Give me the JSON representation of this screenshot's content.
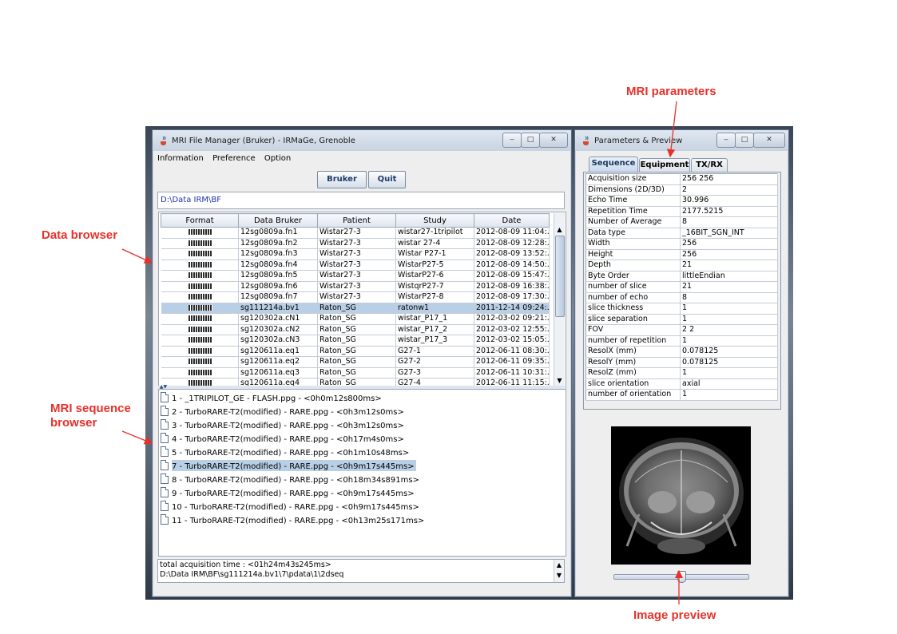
{
  "annotations": {
    "mri_parameters": "MRI parameters",
    "data_browser": "Data browser",
    "mri_sequence_browser": "MRI sequence\nbrowser",
    "image_preview": "Image preview"
  },
  "main_window": {
    "title": "MRI File Manager (Bruker) - IRMaGe, Grenoble",
    "menu": [
      "Information",
      "Preference",
      "Option"
    ],
    "buttons": {
      "bruker": "Bruker",
      "quit": "Quit"
    },
    "path": "D:\\Data IRM\\BF",
    "table": {
      "columns": [
        "Format",
        "Data Bruker",
        "Patient",
        "Study",
        "Date"
      ],
      "rows": [
        [
          "",
          "12sg0809a.fn1",
          "Wistar27-3",
          "wistar27-1tripilot",
          "2012-08-09  11:04:..."
        ],
        [
          "",
          "12sg0809a.fn2",
          "Wistar27-3",
          "wistar 27-4",
          "2012-08-09  12:28:..."
        ],
        [
          "",
          "12sg0809a.fn3",
          "Wistar27-3",
          "Wistar P27-1",
          "2012-08-09  13:52:..."
        ],
        [
          "",
          "12sg0809a.fn4",
          "Wistar27-3",
          "WistarP27-5",
          "2012-08-09  14:50:..."
        ],
        [
          "",
          "12sg0809a.fn5",
          "Wistar27-3",
          "WistarP27-6",
          "2012-08-09  15:47:..."
        ],
        [
          "",
          "12sg0809a.fn6",
          "Wistar27-3",
          "WistqrP27-7",
          "2012-08-09  16:38:..."
        ],
        [
          "",
          "12sg0809a.fn7",
          "Wistar27-3",
          "WistarP27-8",
          "2012-08-09  17:30:..."
        ],
        [
          "",
          "sg111214a.bv1",
          "Raton_SG",
          "ratonw1",
          "2011-12-14  09:24:..."
        ],
        [
          "",
          "sg120302a.cN1",
          "Raton_SG",
          "wistar_P17_1",
          "2012-03-02  09:21:..."
        ],
        [
          "",
          "sg120302a.cN2",
          "Raton_SG",
          "wistar_P17_2",
          "2012-03-02  12:55:..."
        ],
        [
          "",
          "sg120302a.cN3",
          "Raton_SG",
          "wistar_P17_3",
          "2012-03-02  15:05:..."
        ],
        [
          "",
          "sg120611a.eq1",
          "Raton_SG",
          "G27-1",
          "2012-06-11  08:30:..."
        ],
        [
          "",
          "sg120611a.eq2",
          "Raton_SG",
          "G27-2",
          "2012-06-11  09:35:..."
        ],
        [
          "",
          "sg120611a.eq3",
          "Raton_SG",
          "G27-3",
          "2012-06-11  10:31:..."
        ],
        [
          "",
          "sg120611a.eq4",
          "Raton_SG",
          "G27-4",
          "2012-06-11  11:15:..."
        ]
      ],
      "selected_row": 7
    },
    "sequences": [
      "1 - _1TRIPILOT_GE - FLASH.ppg - <0h0m12s800ms>",
      "2 - TurboRARE-T2(modified) - RARE.ppg - <0h3m12s0ms>",
      "3 - TurboRARE-T2(modified) - RARE.ppg - <0h3m12s0ms>",
      "4 - TurboRARE-T2(modified) - RARE.ppg - <0h17m4s0ms>",
      "5 - TurboRARE-T2(modified) - RARE.ppg - <0h1m10s48ms>",
      "7 - TurboRARE-T2(modified) - RARE.ppg - <0h9m17s445ms>",
      "8 - TurboRARE-T2(modified) - RARE.ppg - <0h18m34s891ms>",
      "9 - TurboRARE-T2(modified) - RARE.ppg - <0h9m17s445ms>",
      "10 - TurboRARE-T2(modified) - RARE.ppg - <0h9m17s445ms>",
      "11 - TurboRARE-T2(modified) - RARE.ppg - <0h13m25s171ms>"
    ],
    "selected_sequence": 5,
    "status_lines": [
      "total acquisition time : <01h24m43s245ms>",
      "D:\\Data IRM\\BF\\sg111214a.bv1\\7\\pdata\\1\\2dseq"
    ]
  },
  "param_window": {
    "title": "Parameters & Preview",
    "tabs": [
      "Sequence",
      "Equipment",
      "TX/RX"
    ],
    "active_tab": 0,
    "params": [
      [
        "Acquisition size",
        "256 256"
      ],
      [
        "Dimensions (2D/3D)",
        "2"
      ],
      [
        "Echo Time",
        "30.996"
      ],
      [
        "Repetition Time",
        "2177.5215"
      ],
      [
        "Number of Average",
        "8"
      ],
      [
        "Data type",
        "_16BIT_SGN_INT"
      ],
      [
        "Width",
        "256"
      ],
      [
        "Height",
        "256"
      ],
      [
        "Depth",
        "21"
      ],
      [
        "Byte Order",
        "littleEndian"
      ],
      [
        "number of slice",
        "21"
      ],
      [
        "number of echo",
        "8"
      ],
      [
        "slice thickness",
        "1"
      ],
      [
        "slice separation",
        "1"
      ],
      [
        "FOV",
        "2 2"
      ],
      [
        "number of repetition",
        "1"
      ],
      [
        "ResolX (mm)",
        "0.078125"
      ],
      [
        "ResolY (mm)",
        "0.078125"
      ],
      [
        "ResolZ (mm)",
        "1"
      ],
      [
        "slice orientation",
        "axial"
      ],
      [
        "number of orientation",
        "1"
      ]
    ],
    "slider_fraction": 0.5
  }
}
